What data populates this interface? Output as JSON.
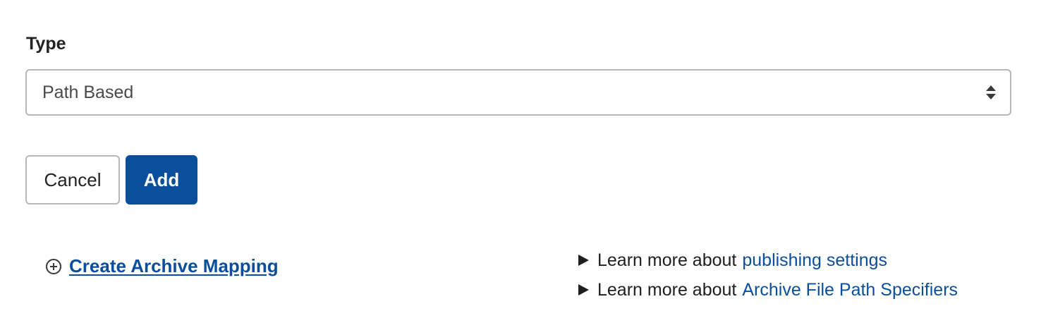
{
  "form": {
    "type_label": "Type",
    "type_select": {
      "selected": "Path Based"
    }
  },
  "actions": {
    "cancel_label": "Cancel",
    "add_label": "Add"
  },
  "create_mapping": {
    "label": "Create Archive Mapping",
    "icon": "plus-circle-icon"
  },
  "learn_more": [
    {
      "prefix": "Learn more about",
      "link": "publishing settings"
    },
    {
      "prefix": "Learn more about",
      "link": "Archive File Path Specifiers"
    }
  ],
  "colors": {
    "primary": "#0b4f9c",
    "border": "#b7b7b7",
    "text": "#1f1f1f"
  }
}
